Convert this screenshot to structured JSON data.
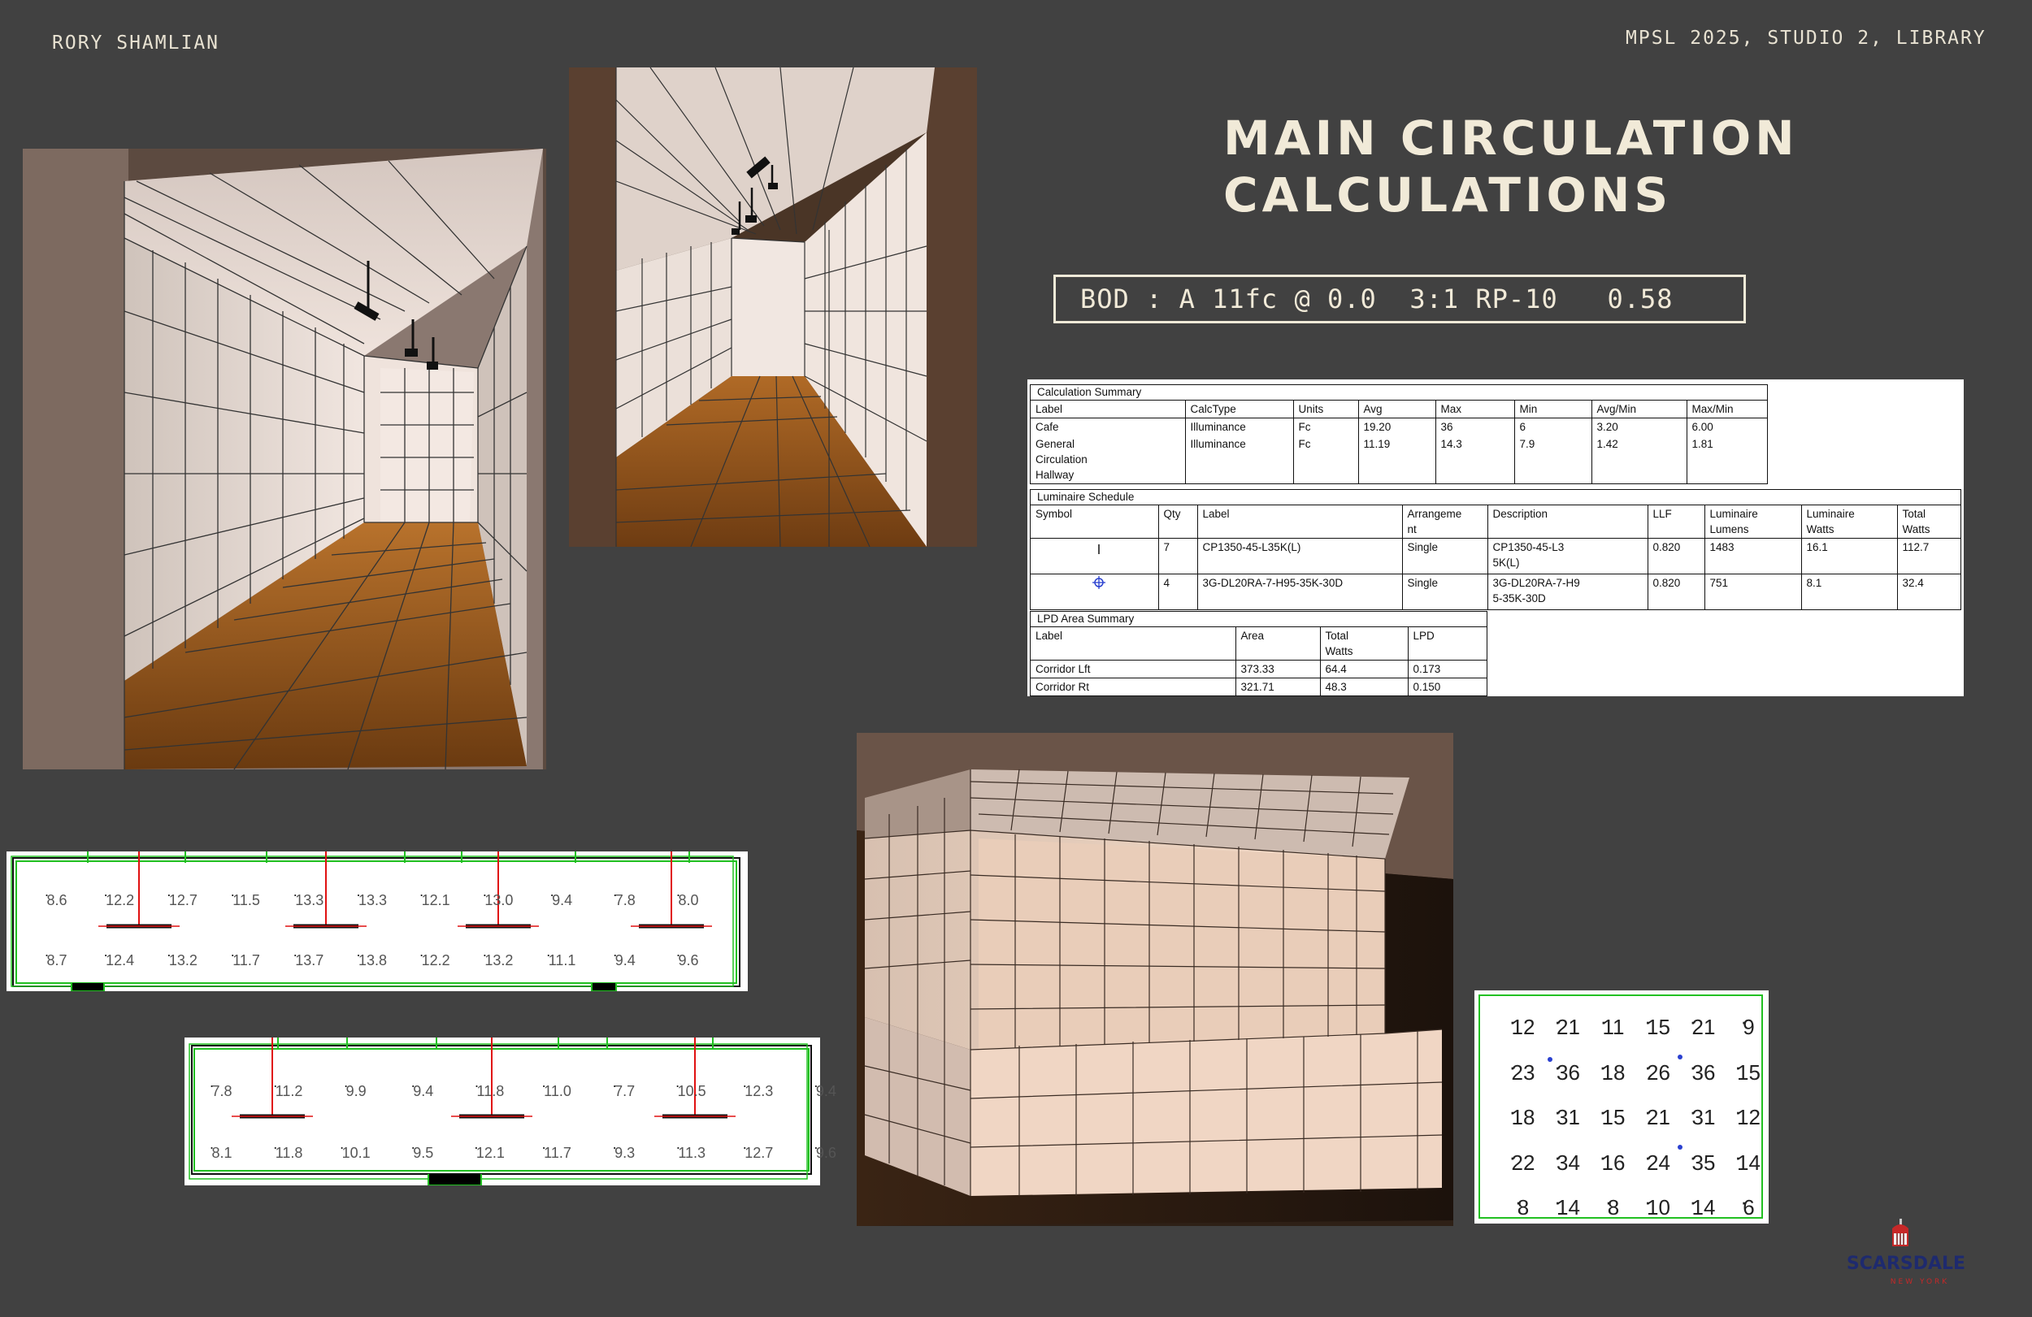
{
  "header": {
    "author": "RORY SHAMLIAN",
    "project": "MPSL 2025, STUDIO 2, LIBRARY",
    "title_line1": "MAIN CIRCULATION",
    "title_line2": "CALCULATIONS",
    "bod": "BOD : A 11fc @ 0.0  3:1 RP-10   0.58"
  },
  "calculation_summary": {
    "caption": "Calculation Summary",
    "headers": [
      "Label",
      "CalcType",
      "Units",
      "Avg",
      "Max",
      "Min",
      "Avg/Min",
      "Max/Min"
    ],
    "rows": [
      [
        "Cafe",
        "Illuminance",
        "Fc",
        "19.20",
        "36",
        "6",
        "3.20",
        "6.00"
      ],
      [
        "General Circulation Hallway",
        "Illuminance",
        "Fc",
        "11.19",
        "14.3",
        "7.9",
        "1.42",
        "1.81"
      ]
    ]
  },
  "luminaire_schedule": {
    "caption": "Luminaire Schedule",
    "headers": [
      "Symbol",
      "Qty",
      "Label",
      "Arrangement",
      "Description",
      "LLF",
      "Luminaire Lumens",
      "Luminaire Watts",
      "Total Watts"
    ],
    "rows": [
      [
        "linear-pendant-symbol",
        "7",
        "CP1350-45-L35K(L)",
        "Single",
        "CP1350-45-L35K(L)",
        "0.820",
        "1483",
        "16.1",
        "112.7"
      ],
      [
        "downlight-symbol",
        "4",
        "3G-DL20RA-7-H95-35K-30D",
        "Single",
        "3G-DL20RA-7-H95-35K-30D",
        "0.820",
        "751",
        "8.1",
        "32.4"
      ]
    ]
  },
  "lpd_area_summary": {
    "caption": "LPD Area Summary",
    "headers": [
      "Label",
      "Area",
      "Total Watts",
      "LPD"
    ],
    "rows": [
      [
        "Corridor Lft",
        "373.33",
        "64.4",
        "0.173"
      ],
      [
        "Corridor Rt",
        "321.71",
        "48.3",
        "0.150"
      ]
    ]
  },
  "point_grid_left_corridor": {
    "row1": [
      "8.6",
      "12.2",
      "12.7",
      "11.5",
      "13.3",
      "13.3",
      "12.1",
      "13.0",
      "9.4",
      "7.8",
      "8.0"
    ],
    "row2": [
      "8.7",
      "12.4",
      "13.2",
      "11.7",
      "13.7",
      "13.8",
      "12.2",
      "13.2",
      "11.1",
      "9.4",
      "9.6"
    ]
  },
  "point_grid_right_corridor": {
    "row1": [
      "7.8",
      "11.2",
      "9.9",
      "9.4",
      "11.8",
      "11.0",
      "7.7",
      "10.5",
      "12.3",
      "9.4"
    ],
    "row2": [
      "8.1",
      "11.8",
      "10.1",
      "9.5",
      "12.1",
      "11.7",
      "9.3",
      "11.3",
      "12.7",
      "9.6"
    ]
  },
  "point_grid_cafe": {
    "rows": [
      [
        "12",
        "21",
        "11",
        "15",
        "21",
        "9"
      ],
      [
        "23",
        "36",
        "18",
        "26",
        "36",
        "15"
      ],
      [
        "18",
        "31",
        "15",
        "21",
        "31",
        "12"
      ],
      [
        "22",
        "34",
        "16",
        "24",
        "35",
        "14"
      ],
      [
        "8",
        "14",
        "8",
        "10",
        "14",
        "6"
      ]
    ]
  },
  "logo": {
    "name": "SCARSDALE",
    "sub": "NEW YORK"
  },
  "colors": {
    "background": "#414141",
    "text": "#ece6d6",
    "wood_floor": "#9a5a1c",
    "grid_green": "#22c022",
    "grid_red": "#e01010"
  }
}
